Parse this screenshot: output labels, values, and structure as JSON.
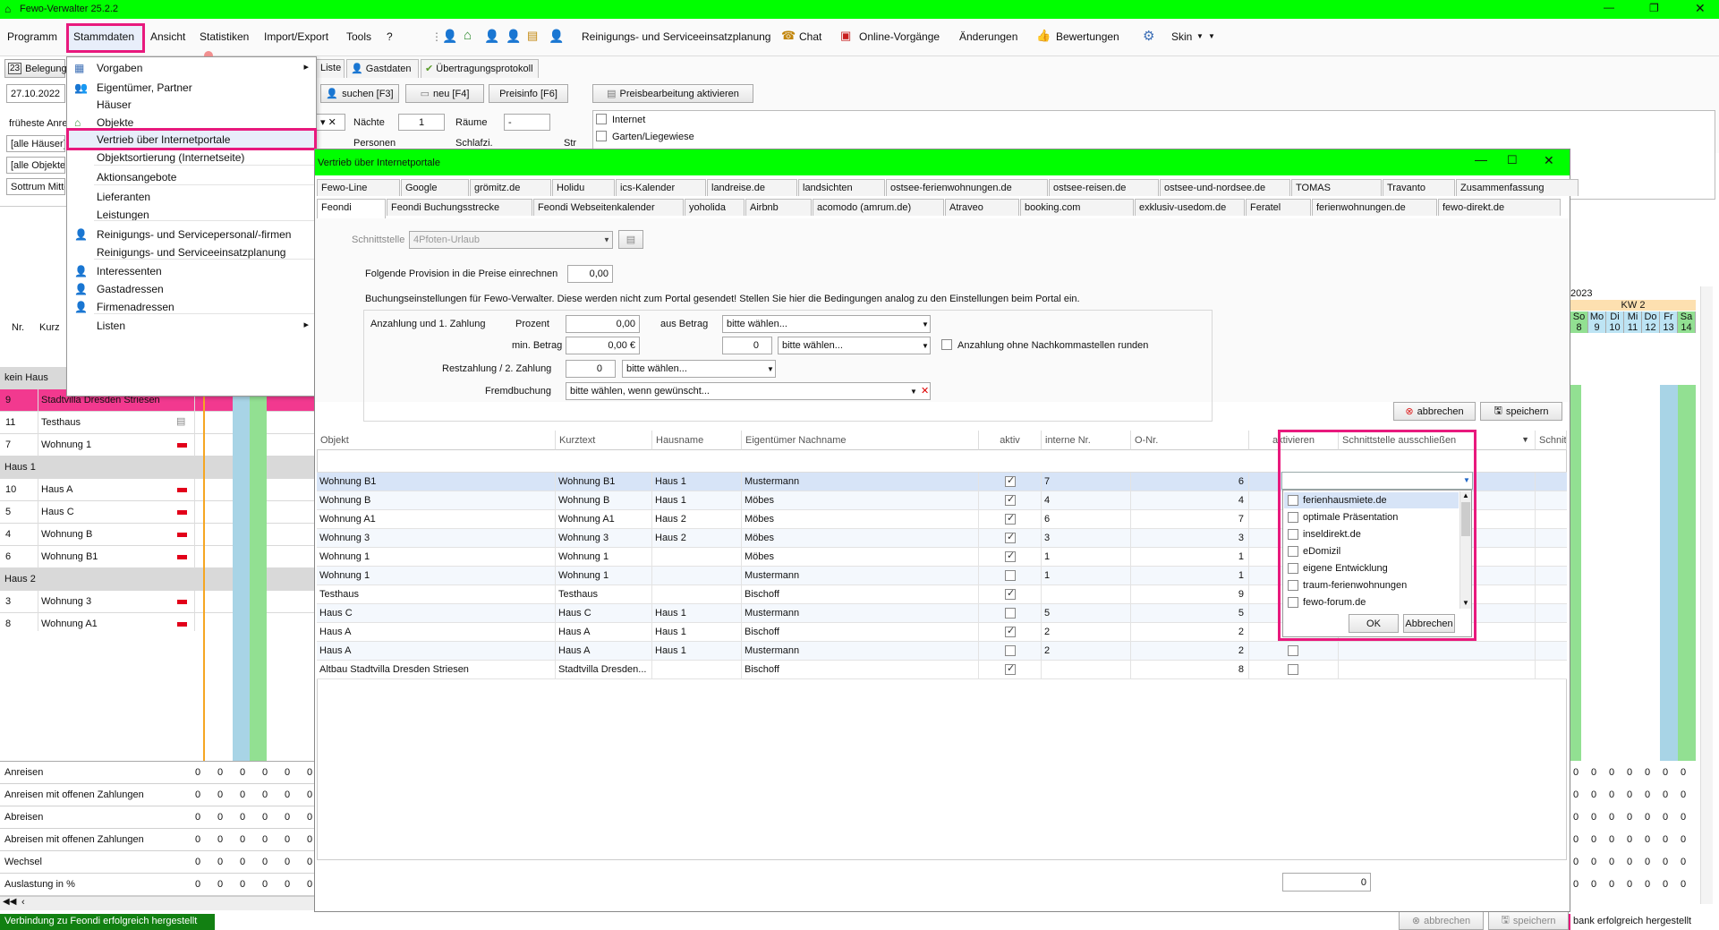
{
  "window": {
    "title": "Fewo-Verwalter 25.2.2"
  },
  "menubar": {
    "items": [
      "Programm",
      "Stammdaten",
      "Ansicht",
      "Statistiken",
      "Import/Export",
      "Tools",
      "?"
    ],
    "toolbar": {
      "reinigung": "Reinigungs- und Serviceeinsatzplanung",
      "chat": "Chat",
      "online": "Online-Vorgänge",
      "aenderungen": "Änderungen",
      "bewertungen": "Bewertungen",
      "skin": "Skin"
    }
  },
  "stammdaten_menu": {
    "items": [
      "Vorgaben",
      "Eigentümer, Partner",
      "Häuser",
      "Objekte",
      "Vertrieb über Internetportale",
      "Objektsortierung (Internetseite)",
      "Aktionsangebote",
      "Lieferanten",
      "Leistungen",
      "Reinigungs- und Servicepersonal/-firmen",
      "Reinigungs- und Serviceeinsatzplanung",
      "Interessenten",
      "Gastadressen",
      "Firmenadressen",
      "Listen"
    ]
  },
  "left": {
    "belegung": "Belegung",
    "date": "27.10.2022",
    "frueheste": "früheste Anre",
    "haeuser": "[alle Häuser]",
    "objekte": "[alle Objekte",
    "sort": "Sottrum Mitte",
    "col_nr": "Nr.",
    "col_kurz": "Kurz",
    "rows": [
      {
        "type": "group",
        "label": "kein Haus"
      },
      {
        "type": "row",
        "nr": "9",
        "kurz": "Stadtvilla Dresden Striesen",
        "selected": true
      },
      {
        "type": "row",
        "nr": "11",
        "kurz": "Testhaus"
      },
      {
        "type": "row",
        "nr": "7",
        "kurz": "Wohnung 1"
      },
      {
        "type": "group",
        "label": "Haus 1"
      },
      {
        "type": "row",
        "nr": "10",
        "kurz": "Haus A"
      },
      {
        "type": "row",
        "nr": "5",
        "kurz": "Haus C"
      },
      {
        "type": "row",
        "nr": "4",
        "kurz": "Wohnung B"
      },
      {
        "type": "row",
        "nr": "6",
        "kurz": "Wohnung B1"
      },
      {
        "type": "group",
        "label": "Haus 2"
      },
      {
        "type": "row",
        "nr": "3",
        "kurz": "Wohnung 3"
      },
      {
        "type": "row",
        "nr": "8",
        "kurz": "Wohnung A1"
      }
    ],
    "stats": [
      "Anreisen",
      "Anreisen mit offenen Zahlungen",
      "Abreisen",
      "Abreisen mit offenen Zahlungen",
      "Wechsel",
      "Auslastung in %"
    ],
    "stat_value": "0",
    "status": "Verbindung zu Feondi erfolgreich hergestellt"
  },
  "back": {
    "tabs": [
      "Liste",
      "Gastdaten",
      "Übertragungsprotokoll"
    ],
    "suchen": "suchen [F3]",
    "neu": "neu [F4]",
    "preisinfo": "Preisinfo [F6]",
    "preisbearbeitung": "Preisbearbeitung aktivieren",
    "naechte": "Nächte",
    "naechte_val": "1",
    "raeume": "Räume",
    "raeume_val": "-",
    "personen": "Personen",
    "schlafzi": "Schlafzi.",
    "str": "Str",
    "internet": "Internet",
    "garten": "Garten/Liegewiese",
    "cal_year": "2023",
    "cal_kw": "KW 2",
    "cal_days": [
      "So",
      "Mo",
      "Di",
      "Mi",
      "Do",
      "Fr",
      "Sa"
    ],
    "cal_nums": [
      "8",
      "9",
      "10",
      "11",
      "12",
      "13",
      "14"
    ],
    "status_right": "bank erfolgreich hergestellt",
    "abbrechen": "abbrechen",
    "speichern": "speichern"
  },
  "dialog": {
    "title": "Vertrieb über Internetportale",
    "tabs_row1": [
      "Fewo-Line",
      "Google",
      "grömitz.de",
      "Holidu",
      "ics-Kalender",
      "landreise.de",
      "landsichten",
      "ostsee-ferienwohnungen.de",
      "ostsee-reisen.de",
      "ostsee-und-nordsee.de",
      "TOMAS",
      "Travanto",
      "Zusammenfassung"
    ],
    "tabs_row2": [
      "Feondi",
      "Feondi Buchungsstrecke",
      "Feondi Webseitenkalender",
      "yoholida",
      "Airbnb",
      "acomodo (amrum.de)",
      "Atraveo",
      "booking.com",
      "exklusiv-usedom.de",
      "Feratel",
      "ferienwohnungen.de",
      "fewo-direkt.de"
    ],
    "schnittstelle_label": "Schnittstelle",
    "schnittstelle_val": "4Pfoten-Urlaub",
    "provision_label": "Folgende Provision in die Preise einrechnen",
    "provision_val": "0,00",
    "buchung_note": "Buchungseinstellungen für Fewo-Verwalter. Diese werden nicht zum Portal gesendet! Stellen Sie hier die Bedingungen analog zu den Einstellungen beim Portal ein.",
    "anzahlung_label": "Anzahlung und 1. Zahlung",
    "prozent_label": "Prozent",
    "prozent_val": "0,00",
    "ausbetrag_label": "aus Betrag",
    "bitte": "bitte wählen...",
    "minbetrag_label": "min. Betrag",
    "minbetrag_val": "0,00 €",
    "spin0": "0",
    "ohne_nachkomma": "Anzahlung ohne Nachkommastellen runden",
    "rest_label": "Restzahlung / 2. Zahlung",
    "fremd_label": "Fremdbuchung",
    "fremd_val": "bitte wählen, wenn gewünscht...",
    "abbrechen": "abbrechen",
    "speichern": "speichern",
    "columns": [
      "Objekt",
      "Kurztext",
      "Hausname",
      "Eigentümer Nachname",
      "aktiv",
      "interne Nr.",
      "O-Nr.",
      "aktivieren",
      "Schnittstelle ausschließen",
      "Schnittstellennr."
    ],
    "rows": [
      {
        "objekt": "Wohnung B1",
        "kurz": "Wohnung B1",
        "haus": "Haus 1",
        "eig": "Mustermann",
        "aktiv": true,
        "inr": "7",
        "onr": "6",
        "sel": true
      },
      {
        "objekt": "Wohnung B",
        "kurz": "Wohnung B",
        "haus": "Haus 1",
        "eig": "Möbes",
        "aktiv": true,
        "inr": "4",
        "onr": "4"
      },
      {
        "objekt": "Wohnung A1",
        "kurz": "Wohnung A1",
        "haus": "Haus 2",
        "eig": "Möbes",
        "aktiv": true,
        "inr": "6",
        "onr": "7"
      },
      {
        "objekt": "Wohnung 3",
        "kurz": "Wohnung 3",
        "haus": "Haus 2",
        "eig": "Möbes",
        "aktiv": true,
        "inr": "3",
        "onr": "3"
      },
      {
        "objekt": "Wohnung 1",
        "kurz": "Wohnung 1",
        "haus": "",
        "eig": "Möbes",
        "aktiv": true,
        "inr": "1",
        "onr": "1"
      },
      {
        "objekt": "Wohnung 1",
        "kurz": "Wohnung 1",
        "haus": "",
        "eig": "Mustermann",
        "aktiv": false,
        "inr": "1",
        "onr": "1"
      },
      {
        "objekt": "Testhaus",
        "kurz": "Testhaus",
        "haus": "",
        "eig": "Bischoff",
        "aktiv": true,
        "inr": "",
        "onr": "9"
      },
      {
        "objekt": "Haus C",
        "kurz": "Haus C",
        "haus": "Haus 1",
        "eig": "Mustermann",
        "aktiv": false,
        "inr": "5",
        "onr": "5"
      },
      {
        "objekt": "Haus A",
        "kurz": "Haus A",
        "haus": "Haus 1",
        "eig": "Bischoff",
        "aktiv": true,
        "inr": "2",
        "onr": "2"
      },
      {
        "objekt": "Haus A",
        "kurz": "Haus A",
        "haus": "Haus 1",
        "eig": "Mustermann",
        "aktiv": false,
        "inr": "2",
        "onr": "2"
      },
      {
        "objekt": "Altbau Stadtvilla Dresden Striesen",
        "kurz": "Stadtvilla Dresden...",
        "haus": "",
        "eig": "Bischoff",
        "aktiv": true,
        "inr": "",
        "onr": "8"
      }
    ],
    "footer_sum": "0",
    "exclude_popup": {
      "options": [
        "ferienhausmiete.de",
        "optimale Präsentation",
        "inseldirekt.de",
        "eDomizil",
        "eigene Entwicklung",
        "traum-ferienwohnungen",
        "fewo-forum.de"
      ],
      "ok": "OK",
      "cancel": "Abbrechen"
    }
  },
  "colors": {
    "green": "#00ff00",
    "pink": "#e8197d",
    "selrow": "#d7e4f7"
  }
}
